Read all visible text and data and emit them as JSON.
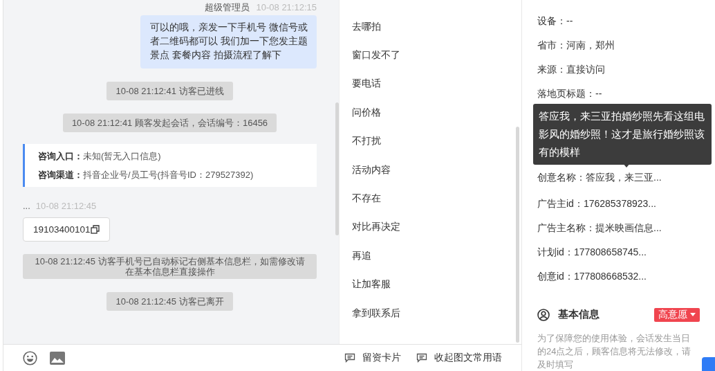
{
  "chat": {
    "messages": [
      {
        "kind": "sender_line",
        "name": "超级管理员",
        "time": "10-08 21:12:15"
      },
      {
        "kind": "bubble",
        "text": "可以的哦，亲发一下手机号 微信号或者二维码都可以 我们加一下您发主题景点 套餐内容 拍摄流程了解下"
      },
      {
        "kind": "system",
        "text": "10-08 21:12:41 访客已进线"
      },
      {
        "kind": "system",
        "text": "10-08 21:12:41 顾客发起会话，会话编号：16456"
      },
      {
        "kind": "info_card",
        "fields": [
          {
            "label": "咨询入口：",
            "value": "未知(暂无入口信息)"
          },
          {
            "label": "咨询渠道：",
            "value": "抖音企业号/员工号(抖音号ID：279527392)"
          }
        ]
      },
      {
        "kind": "visitor_line",
        "name": "...",
        "time": "10-08 21:12:45"
      },
      {
        "kind": "phone",
        "text": "19103400101"
      },
      {
        "kind": "system",
        "text": "10-08 21:12:45 访客手机号已自动标记右侧基本信息栏，如需修改请在基本信息栏直接操作"
      },
      {
        "kind": "system",
        "text": "10-08 21:12:45 访客已离开"
      }
    ]
  },
  "phrases": [
    "去哪拍",
    "窗口发不了",
    "要电话",
    "问价格",
    "不打扰",
    "活动内容",
    "不存在",
    "对比再决定",
    "再追",
    "让加客服",
    "拿到联系后"
  ],
  "toolbar": {
    "actions": [
      "留资卡片",
      "收起图文常用语"
    ]
  },
  "info": {
    "rows": [
      {
        "text": "设备：--"
      },
      {
        "text": "省市：河南，郑州"
      },
      {
        "text": "来源：直接访问"
      },
      {
        "text": "落地页标题：--"
      },
      {
        "text": "创意名称：答应我，来三亚...",
        "tooltip": "答应我，来三亚拍婚纱照先看这组电影风的婚纱照！这才是旅行婚纱照该有的模样"
      },
      {
        "text": "广告主id：176285378923..."
      },
      {
        "text": "广告主名称：提米映画信息..."
      },
      {
        "text": "计划id：177808658745..."
      },
      {
        "text": "创意id：177808668532..."
      }
    ],
    "basic": {
      "title": "基本信息",
      "tag": "高意愿",
      "note": "为了保障您的使用体验，会话发生当日的24点之后，顾客信息将无法修改，请及时填写"
    }
  }
}
